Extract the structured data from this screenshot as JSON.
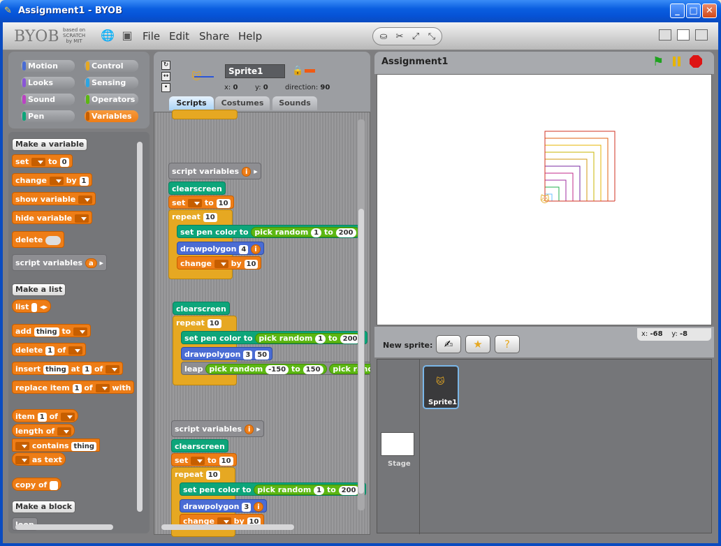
{
  "window": {
    "title": "Assignment1 - BYOB",
    "min": "_",
    "max": "□",
    "close": "✕"
  },
  "logo": {
    "text": "BYOB",
    "sub1": "based on",
    "sub2": "SCRATCH",
    "sub3": "by MIT"
  },
  "menu": {
    "file": "File",
    "edit": "Edit",
    "share": "Share",
    "help": "Help"
  },
  "categories": {
    "motion": "Motion",
    "control": "Control",
    "looks": "Looks",
    "sensing": "Sensing",
    "sound": "Sound",
    "operators": "Operators",
    "pen": "Pen",
    "variables": "Variables"
  },
  "palette": {
    "make_variable": "Make a variable",
    "set": "set",
    "to": "to",
    "set_val": "0",
    "change": "change",
    "by": "by",
    "change_val": "1",
    "show_variable": "show variable",
    "hide_variable": "hide variable",
    "delete": "delete",
    "script_variables": "script variables",
    "script_var_a": "a",
    "make_list": "Make a list",
    "list": "list",
    "add": "add",
    "thing": "thing",
    "delete_of": "of",
    "one": "1",
    "insert": "insert",
    "at": "at",
    "replace_item": "replace item",
    "with": "with",
    "item": "item",
    "length_of": "length of",
    "contains": "contains",
    "as_text": "as text",
    "copy_of": "copy of",
    "make_block": "Make a block",
    "last_partial": "loop"
  },
  "sprite": {
    "name": "Sprite1",
    "x_label": "x:",
    "x": "0",
    "y_label": "y:",
    "y": "0",
    "dir_label": "direction:",
    "dir": "90"
  },
  "tabs": {
    "scripts": "Scripts",
    "costumes": "Costumes",
    "sounds": "Sounds"
  },
  "scripts": {
    "sv": "script variables",
    "i": "i",
    "clearscreen": "clearscreen",
    "set": "set",
    "to": "to",
    "ten": "10",
    "repeat": "repeat",
    "setpen": "set pen color to",
    "pick_random": "pick random",
    "one": "1",
    "r200": "200",
    "drawpolygon": "drawpolygon",
    "four": "4",
    "three": "3",
    "fifty": "50",
    "change": "change",
    "by": "by",
    "leap": "leap",
    "neg150": "-150",
    "p150": "150",
    "pick_rand_cut": "pick rand"
  },
  "stage": {
    "title": "Assignment1",
    "mouse_x_label": "x:",
    "mouse_x": "-68",
    "mouse_y_label": "y:",
    "mouse_y": "-8"
  },
  "new_sprite": {
    "label": "New sprite:"
  },
  "library": {
    "stage": "Stage",
    "sprite1": "Sprite1"
  },
  "colors": {
    "variables": "#ee7d16",
    "pen": "#0da57a",
    "control": "#e6a822",
    "operators": "#5cb712",
    "motion": "#4a6cd4"
  }
}
